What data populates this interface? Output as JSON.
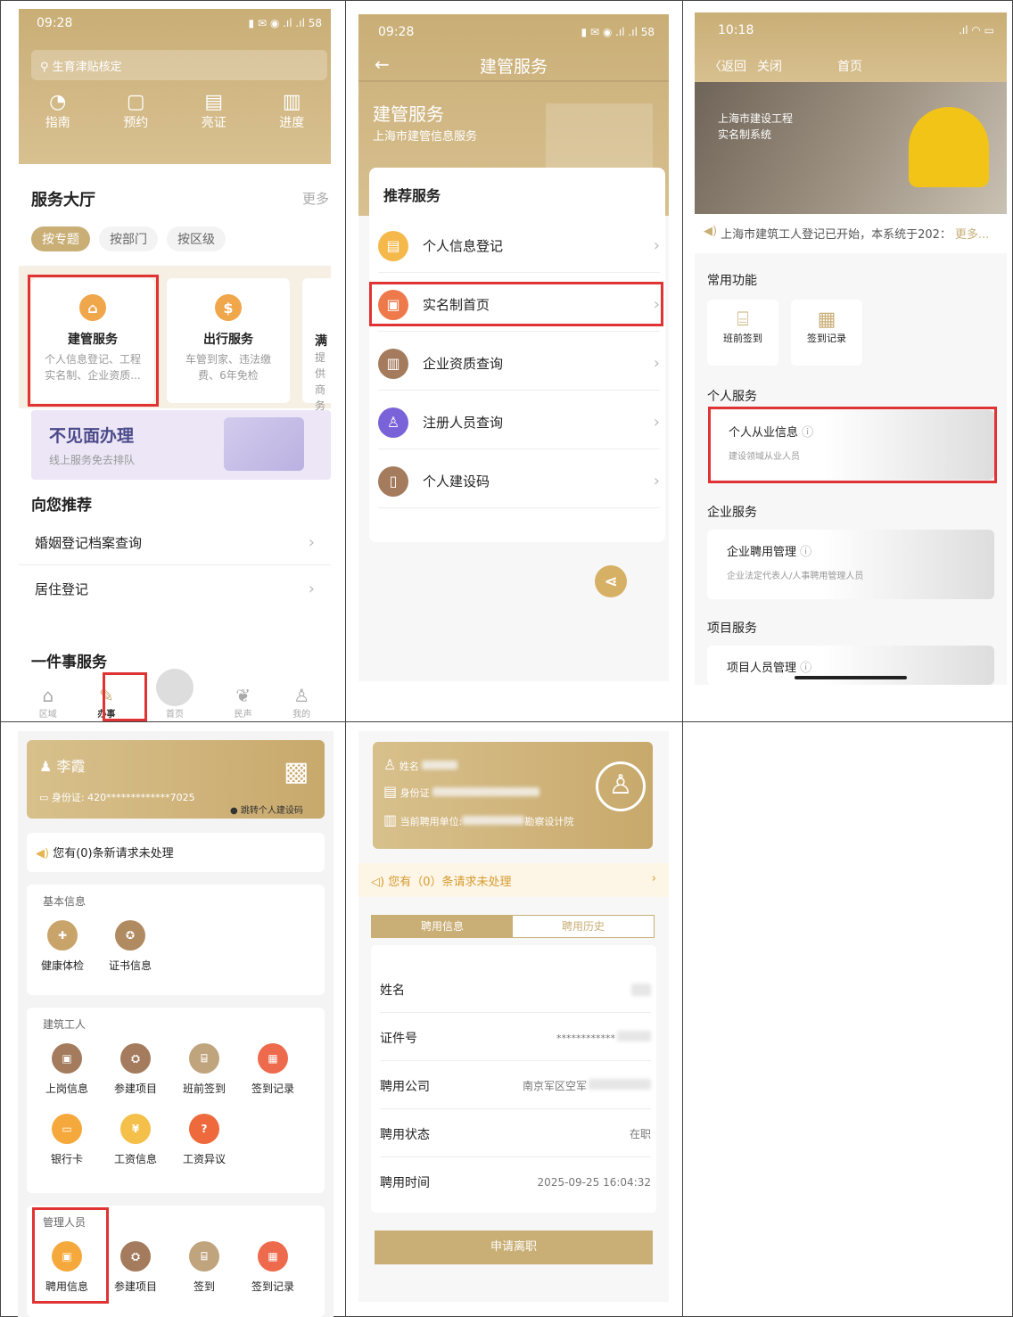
{
  "p1": {
    "time": "09:28",
    "battery": "58",
    "search_placeholder": "生育津贴核定",
    "quick": [
      "指南",
      "预约",
      "亮证",
      "进度"
    ],
    "hall_title": "服务大厅",
    "more": "更多",
    "tabs": [
      "按专题",
      "按部门",
      "按区级"
    ],
    "cards": [
      {
        "title": "建管服务",
        "desc": "个人信息登记、工程实名制、企业资质..."
      },
      {
        "title": "出行服务",
        "desc": "车管到家、违法缴费、6年免检"
      },
      {
        "title": "满",
        "desc": "提供商务"
      }
    ],
    "banner_title": "不见面办理",
    "banner_sub": "线上服务免去排队",
    "rec_title": "向您推荐",
    "rec_items": [
      "婚姻登记档案查询",
      "居住登记"
    ],
    "one_title": "一件事服务",
    "nav": [
      "区域",
      "办事",
      "首页",
      "民声",
      "我的"
    ]
  },
  "p2": {
    "time": "09:28",
    "battery": "58",
    "title": "建管服务",
    "hero_title": "建管服务",
    "hero_sub": "上海市建管信息服务",
    "section": "推荐服务",
    "items": [
      "个人信息登记",
      "实名制首页",
      "企业资质查询",
      "注册人员查询",
      "个人建设码"
    ]
  },
  "p3": {
    "time": "10:18",
    "back": "〈返回",
    "close": "关闭",
    "title": "首页",
    "hero": [
      "上海市建设工程",
      "实名制系统"
    ],
    "notice": "上海市建筑工人登记已开始，本系统于202：",
    "notice_more": "更多...",
    "common_title": "常用功能",
    "common": [
      "班前签到",
      "签到记录"
    ],
    "personal_title": "个人服务",
    "personal_card": {
      "title": "个人从业信息",
      "sub": "建设领域从业人员"
    },
    "enterprise_title": "企业服务",
    "enterprise_card": {
      "title": "企业聘用管理",
      "sub": "企业法定代表人/人事聘用管理人员"
    },
    "project_title": "项目服务",
    "project_card": {
      "title": "项目人员管理"
    }
  },
  "p4": {
    "name": "李霞",
    "id_label": "身份证: 420*************7025",
    "jump": "跳转个人建设码",
    "notice": "您有(0)条新请求未处理",
    "basic_title": "基本信息",
    "basic": [
      "健康体检",
      "证书信息"
    ],
    "worker_title": "建筑工人",
    "worker": [
      "上岗信息",
      "参建项目",
      "班前签到",
      "签到记录",
      "银行卡",
      "工资信息",
      "工资异议"
    ],
    "manager_title": "管理人员",
    "manager": [
      "聘用信息",
      "参建项目",
      "签到",
      "签到记录"
    ]
  },
  "p5": {
    "name_label": "姓名",
    "id_label": "身份证",
    "unit_label": "当前聘用单位:",
    "unit_value": "勘察设计院",
    "notice": "您有（0）条请求未处理",
    "tabs": [
      "聘用信息",
      "聘用历史"
    ],
    "rows": [
      {
        "k": "姓名",
        "v": ""
      },
      {
        "k": "证件号",
        "v": "************"
      },
      {
        "k": "聘用公司",
        "v": "南京军区空军"
      },
      {
        "k": "聘用状态",
        "v": "在职"
      },
      {
        "k": "聘用时间",
        "v": "2025-09-25 16:04:32"
      }
    ],
    "button": "申请离职"
  },
  "colors": {
    "gold": "#c9ae76",
    "red": "#e03333",
    "orange": "#f0a64a"
  }
}
